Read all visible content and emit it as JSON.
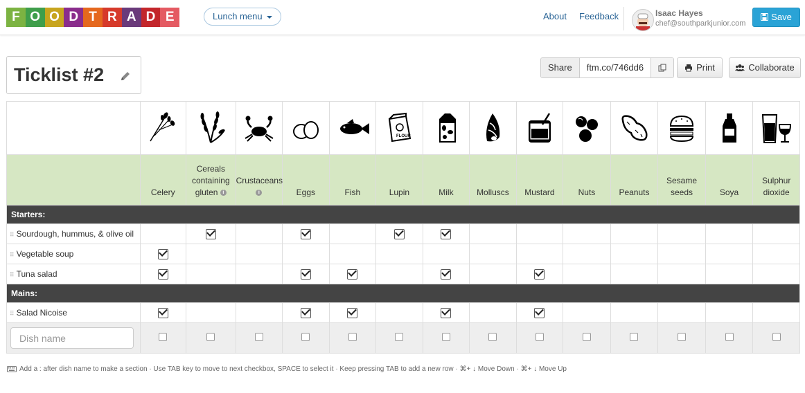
{
  "header": {
    "logo_letters": [
      "F",
      "O",
      "O",
      "D",
      "T",
      "R",
      "A",
      "D",
      "E"
    ],
    "logo_colors": [
      "#7cb342",
      "#3f9e4b",
      "#c8a51e",
      "#8a2d8c",
      "#e5681e",
      "#d63a2b",
      "#6a3a7a",
      "#c3262b",
      "#e45a62"
    ],
    "menu_label": "Lunch menu",
    "about": "About",
    "feedback": "Feedback",
    "user_name": "Isaac Hayes",
    "user_email": "chef@southparkjunior.com",
    "save_label": "Save"
  },
  "ticklist": {
    "title": "Ticklist #2",
    "share_label": "Share",
    "share_url": "ftm.co/746dd6",
    "print_label": "Print",
    "collaborate_label": "Collaborate"
  },
  "allergens": [
    {
      "name": "Celery",
      "icon": "celery-icon"
    },
    {
      "name": "Cereals containing gluten",
      "icon": "wheat-icon",
      "info": true
    },
    {
      "name": "Crustaceans",
      "icon": "crab-icon",
      "info": true
    },
    {
      "name": "Eggs",
      "icon": "eggs-icon"
    },
    {
      "name": "Fish",
      "icon": "fish-icon"
    },
    {
      "name": "Lupin",
      "icon": "flour-bag-icon"
    },
    {
      "name": "Milk",
      "icon": "milk-carton-icon"
    },
    {
      "name": "Molluscs",
      "icon": "shell-icon"
    },
    {
      "name": "Mustard",
      "icon": "mustard-jar-icon"
    },
    {
      "name": "Nuts",
      "icon": "nuts-icon"
    },
    {
      "name": "Peanuts",
      "icon": "peanut-icon"
    },
    {
      "name": "Sesame seeds",
      "icon": "burger-icon"
    },
    {
      "name": "Soya",
      "icon": "soy-bottle-icon"
    },
    {
      "name": "Sulphur dioxide",
      "icon": "wine-glasses-icon"
    }
  ],
  "sections": [
    {
      "name": "Starters:",
      "dishes": [
        {
          "name": "Sourdough, hummus, & olive oil",
          "checks": [
            1,
            3,
            5,
            6
          ]
        },
        {
          "name": "Vegetable soup",
          "checks": [
            0
          ]
        },
        {
          "name": "Tuna salad",
          "checks": [
            0,
            3,
            4,
            6,
            8
          ]
        }
      ]
    },
    {
      "name": "Mains:",
      "dishes": [
        {
          "name": "Salad Nicoise",
          "checks": [
            0,
            3,
            4,
            6,
            8
          ]
        }
      ]
    }
  ],
  "new_dish_placeholder": "Dish name",
  "hint": "Add a : after dish name to make a section · Use TAB key to move to next checkbox, SPACE to select it · Keep pressing TAB to add a new row · ⌘+ ↓ Move Down · ⌘+ ↓ Move Up"
}
